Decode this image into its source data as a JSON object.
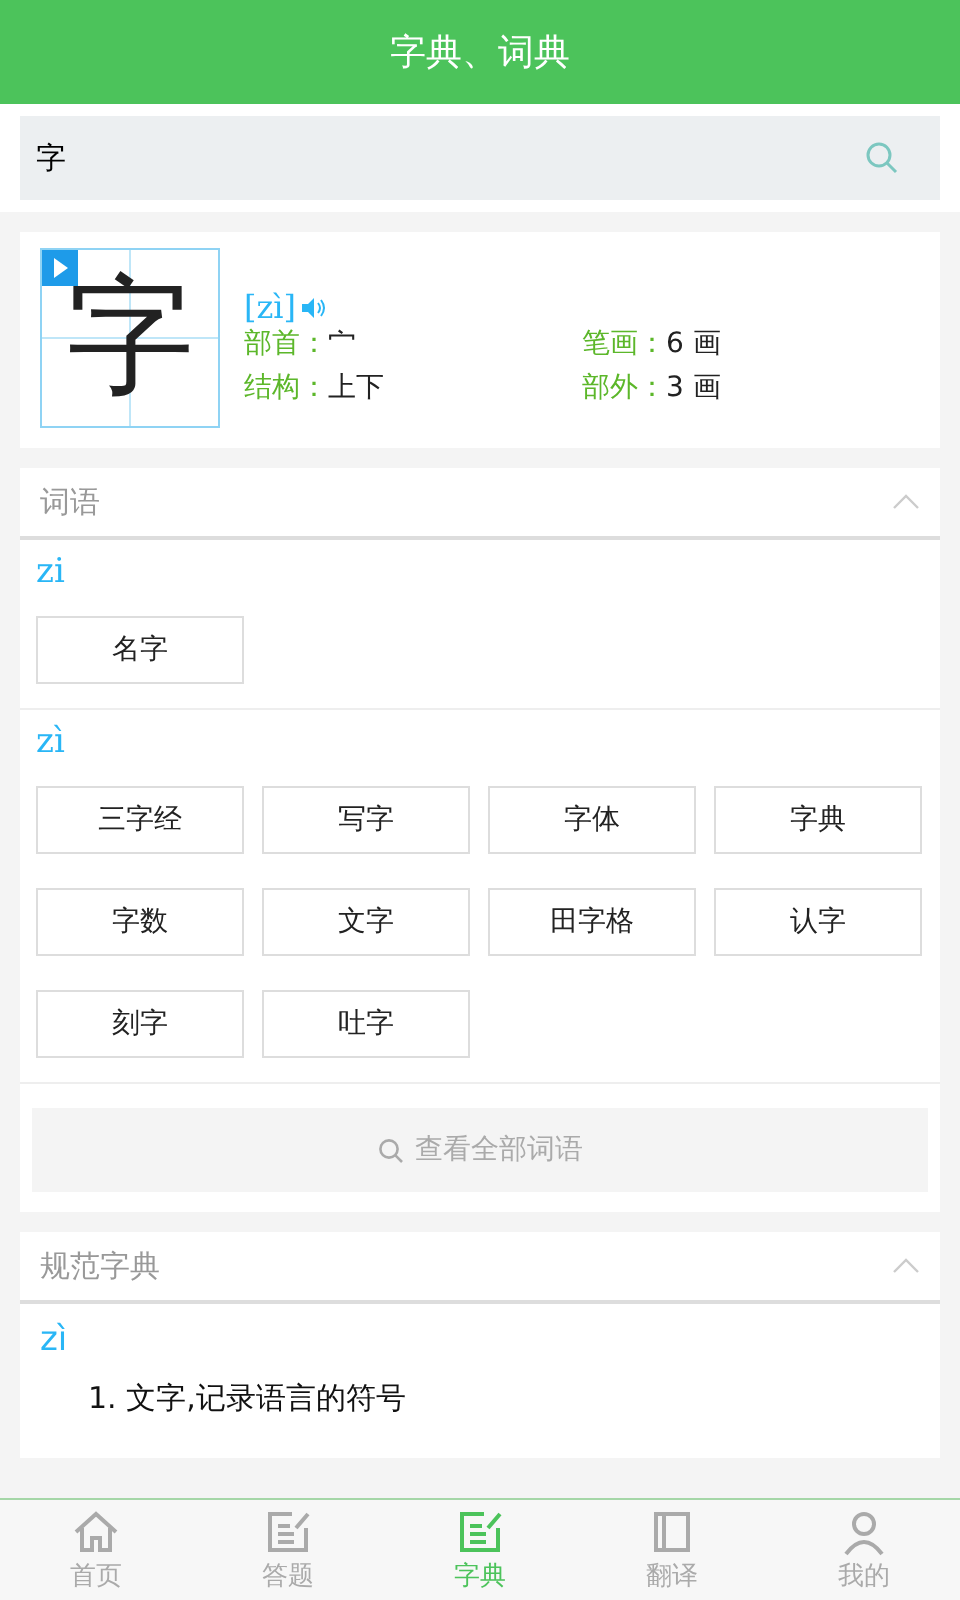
{
  "header": {
    "title": "字典、词典"
  },
  "search": {
    "value": "字"
  },
  "character": {
    "glyph": "字",
    "pinyin": "[zì]",
    "fields": [
      {
        "label": "部首：",
        "value": "宀"
      },
      {
        "label": "笔画：",
        "value": "6 画"
      },
      {
        "label": "结构：",
        "value": "上下"
      },
      {
        "label": "部外：",
        "value": "3 画"
      }
    ]
  },
  "words": {
    "title": "词语",
    "expanded": true,
    "groups": [
      {
        "pinyin": "zi",
        "items": [
          "名字"
        ]
      },
      {
        "pinyin": "zì",
        "items": [
          "三字经",
          "写字",
          "字体",
          "字典",
          "字数",
          "文字",
          "田字格",
          "认字",
          "刻字",
          "吐字"
        ]
      }
    ],
    "more": "查看全部词语"
  },
  "dictionary": {
    "title": "规范字典",
    "expanded": true,
    "pinyin": "zì",
    "definitions": [
      "1. 文字,记录语言的符号"
    ]
  },
  "tabs": [
    {
      "label": "首页",
      "kind": "home",
      "selected": false
    },
    {
      "label": "答题",
      "kind": "edit",
      "selected": false
    },
    {
      "label": "字典",
      "kind": "edit",
      "selected": true
    },
    {
      "label": "翻译",
      "kind": "book",
      "selected": false
    },
    {
      "label": "我的",
      "kind": "user",
      "selected": false
    }
  ]
}
